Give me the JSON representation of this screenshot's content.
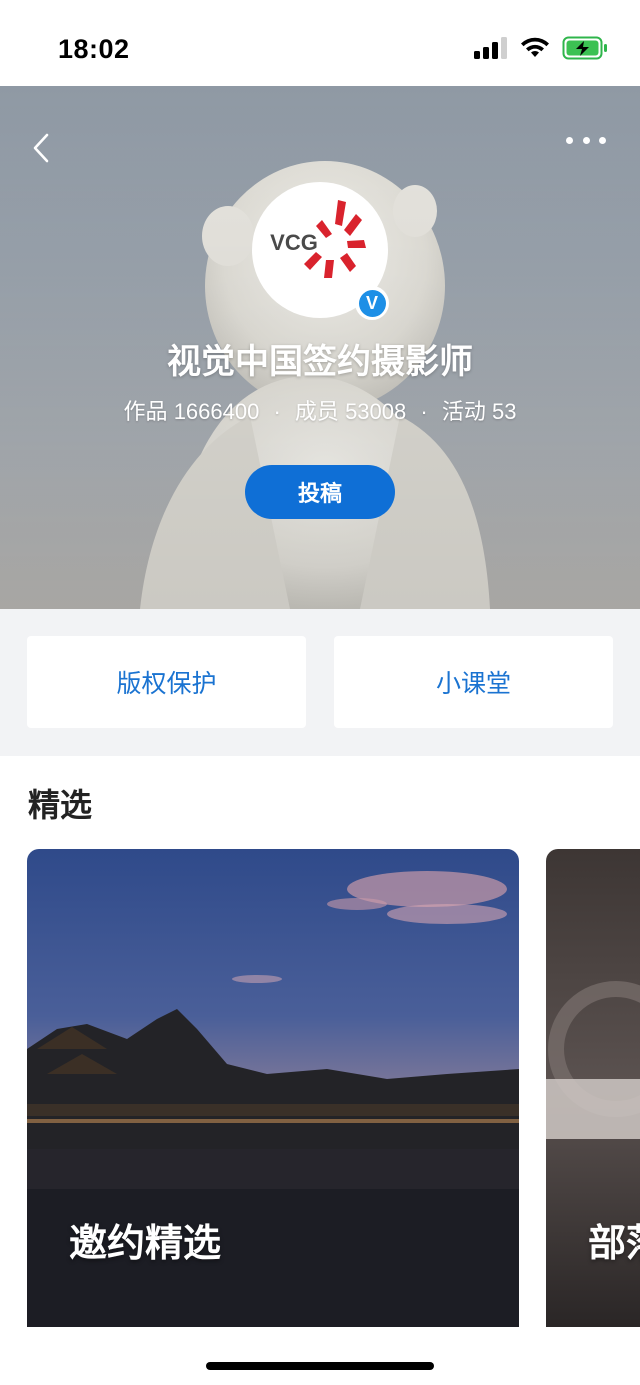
{
  "status_bar": {
    "time": "18:02"
  },
  "header": {
    "title": "视觉中国签约摄影师",
    "avatar_text": "VCG",
    "verified_badge": "V",
    "stats": [
      {
        "label": "作品",
        "value": "1666400"
      },
      {
        "label": "成员",
        "value": "53008"
      },
      {
        "label": "活动",
        "value": "53"
      }
    ],
    "submit_label": "投稿"
  },
  "quick_links": [
    {
      "label": "版权保护"
    },
    {
      "label": "小课堂"
    }
  ],
  "featured": {
    "title": "精选",
    "cards": [
      {
        "label": "邀约精选"
      },
      {
        "label": "部落"
      }
    ]
  },
  "colors": {
    "accent": "#0f6fd6",
    "link": "#1a73d1",
    "logo_red": "#d9232d"
  }
}
